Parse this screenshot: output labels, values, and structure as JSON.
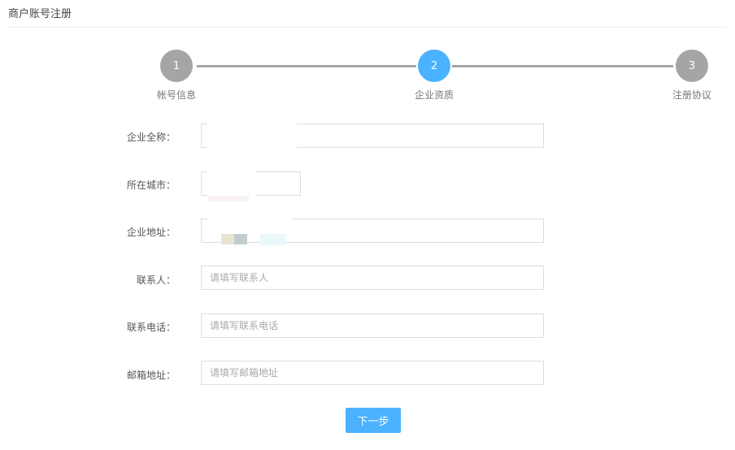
{
  "page_title": "商户账号注册",
  "steps": [
    {
      "num": "1",
      "label": "帐号信息"
    },
    {
      "num": "2",
      "label": "企业资质"
    },
    {
      "num": "3",
      "label": "注册协议"
    }
  ],
  "colors": {
    "accent": "#4ab2ff",
    "inactive": "#a5a5a5"
  },
  "form": {
    "company_name": {
      "label": "企业全称：",
      "value": ""
    },
    "city": {
      "label": "所在城市：",
      "value": ""
    },
    "address": {
      "label": "企业地址：",
      "value": ""
    },
    "contact": {
      "label": "联系人：",
      "placeholder": "请填写联系人"
    },
    "phone": {
      "label": "联系电话：",
      "placeholder": "请填写联系电话"
    },
    "email": {
      "label": "邮箱地址：",
      "placeholder": "请填写邮箱地址"
    }
  },
  "next_button": "下一步"
}
